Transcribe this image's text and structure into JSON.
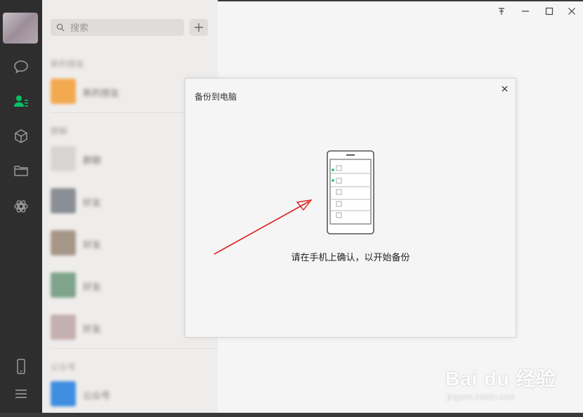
{
  "search": {
    "placeholder": "搜索"
  },
  "add_button_icon": "plus-icon",
  "nav": {
    "items": [
      {
        "name": "chat",
        "icon": "chat-icon"
      },
      {
        "name": "contacts",
        "icon": "contacts-icon",
        "active": true
      },
      {
        "name": "favorites",
        "icon": "cube-icon"
      },
      {
        "name": "files",
        "icon": "folder-icon"
      },
      {
        "name": "moments",
        "icon": "shutter-icon"
      },
      {
        "name": "phone",
        "icon": "phone-icon"
      },
      {
        "name": "menu",
        "icon": "menu-icon"
      }
    ],
    "active_color": "#07c160"
  },
  "contacts_panel": {
    "sections": [
      {
        "title": "新的朋友"
      },
      {
        "title": "群聊"
      },
      {
        "title": "公众号"
      }
    ],
    "items": [
      {
        "name": "新的朋友",
        "avatar_color": "#f3a94f"
      },
      {
        "name": "群聊",
        "avatar_color": "#d8d6d4"
      },
      {
        "name": "好友",
        "avatar_color": "#8a8f95"
      },
      {
        "name": "好友",
        "avatar_color": "#a69688"
      },
      {
        "name": "好友",
        "avatar_color": "#7fa48b"
      },
      {
        "name": "好友",
        "avatar_color": "#c4b0ae"
      },
      {
        "name": "公众号",
        "avatar_color": "#3f8ee0"
      }
    ]
  },
  "window_controls": [
    "pin-icon",
    "minimize-icon",
    "maximize-icon",
    "close-icon"
  ],
  "dialog": {
    "title": "备份到电脑",
    "message": "请在手机上确认，以开始备份",
    "accent_color": "#07c160",
    "arrow_color": "#e02020"
  },
  "watermark": {
    "main": "Bai du 经验",
    "sub": "jingyan.baidu.com"
  }
}
